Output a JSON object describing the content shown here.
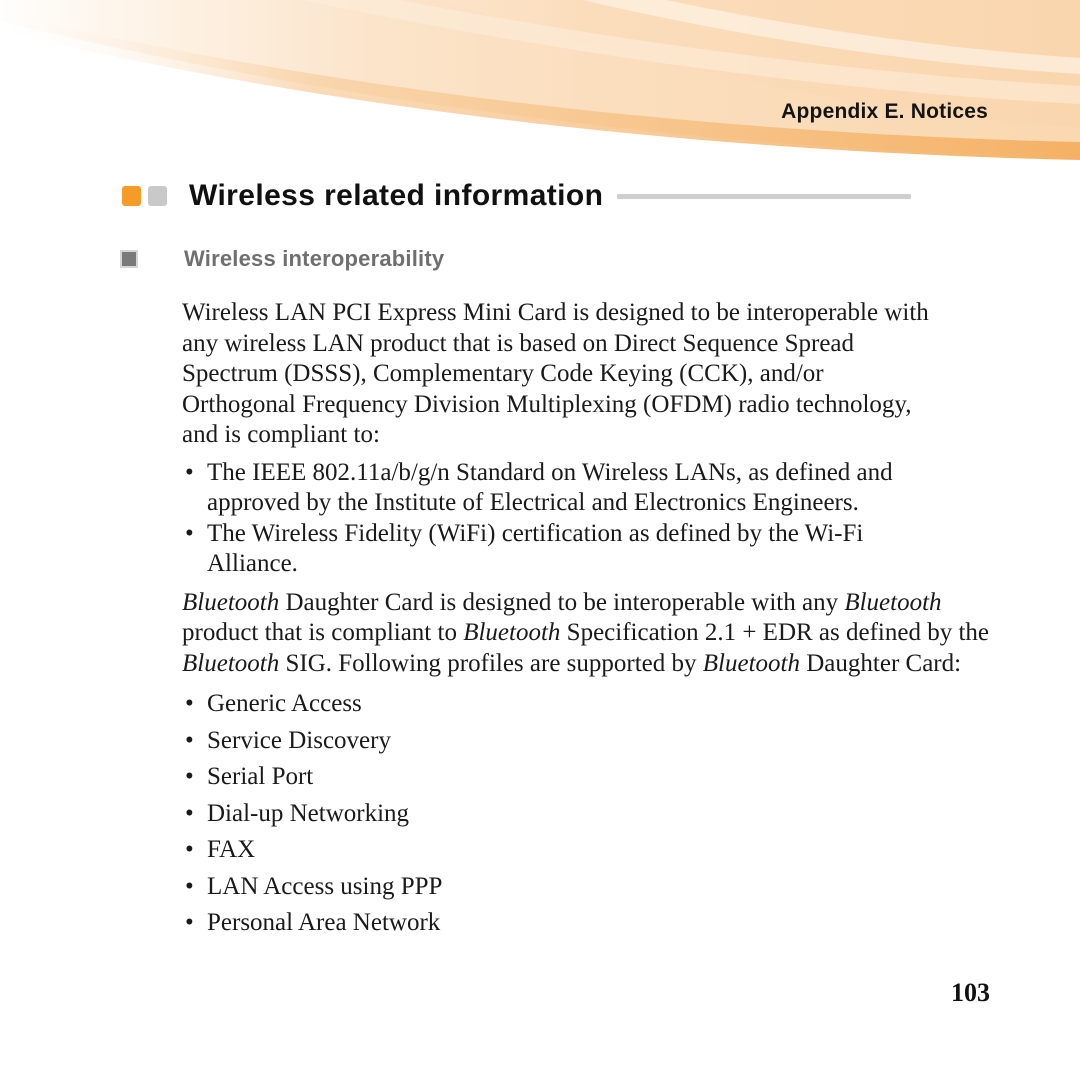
{
  "header": {
    "running_head": "Appendix E. Notices",
    "accent_orange": "#F59B28",
    "accent_gray": "#C9C9C9",
    "band_dark_orange": "#F5B165",
    "band_peach": "#FBDCBA"
  },
  "title": {
    "text": "Wireless related information",
    "rule_color": "#CFCFCF"
  },
  "section": {
    "heading": "Wireless interoperability",
    "heading_color": "#6F6F6F",
    "bullet_color": "#7A7A7A"
  },
  "intro_paragraph": {
    "lines": [
      "Wireless LAN PCI Express Mini Card is designed to be interoperable with",
      "any wireless LAN product that is based on Direct Sequence Spread",
      "Spectrum (DSSS), Complementary Code Keying (CCK), and/or",
      "Orthogonal Frequency Division Multiplexing (OFDM) radio technology,",
      "and is compliant to:"
    ]
  },
  "standards_list": {
    "bullet_glyph": "•",
    "items": [
      {
        "lines": [
          "The IEEE 802.11a/b/g/n Standard on Wireless LANs, as defined and",
          "approved by the Institute of Electrical and Electronics Engineers."
        ]
      },
      {
        "lines": [
          "The Wireless Fidelity (WiFi) certification as defined by the Wi-Fi",
          "Alliance."
        ]
      }
    ]
  },
  "bluetooth_paragraph": {
    "line1_a": "Bluetooth",
    "line1_b": " Daughter Card is designed to be interoperable with any ",
    "line1_c": "Bluetooth",
    "line2_a": "product that is compliant to ",
    "line2_b": "Bluetooth",
    "line2_c": " Specification 2.1 + EDR as defined by the",
    "line3_a": "Bluetooth",
    "line3_b": " SIG. Following profiles are supported by ",
    "line3_c": "Bluetooth",
    "line3_d": " Daughter Card:"
  },
  "profiles_list": {
    "bullet_glyph": "•",
    "items": [
      "Generic Access",
      "Service Discovery",
      "Serial Port",
      "Dial-up Networking",
      "FAX",
      "LAN Access using PPP",
      "Personal Area Network"
    ]
  },
  "footer": {
    "page_number": "103"
  }
}
